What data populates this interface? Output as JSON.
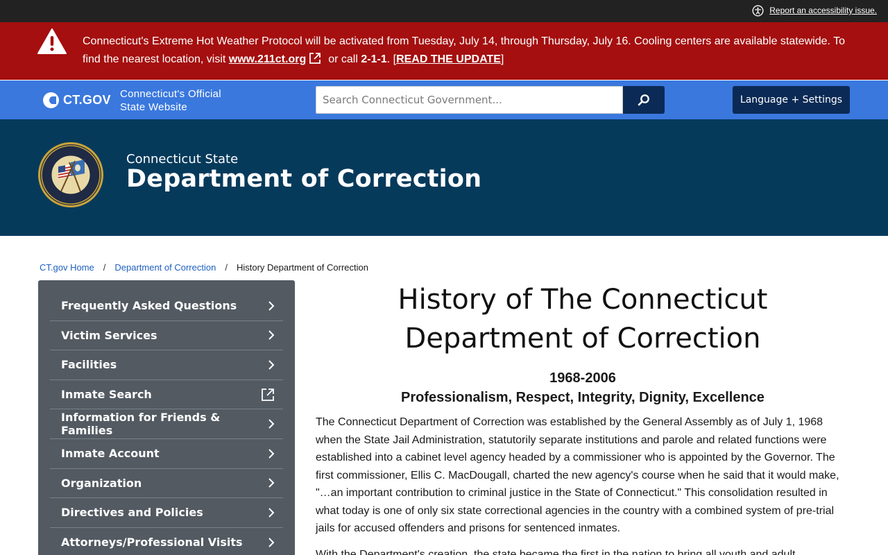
{
  "utility": {
    "accessibility_link": "Report an accessibility issue."
  },
  "alert": {
    "text_before": "Connecticut's Extreme Hot Weather Protocol will be activated from Tuesday, July 14, through Thursday, July 16. Cooling centers are available statewide. To find the nearest location, visit ",
    "link": "www.211ct.org",
    "text_mid": "or call ",
    "phone": "2-1-1",
    "text_after": ". [",
    "read_update": "READ THE UPDATE",
    "close_bracket": "]"
  },
  "ctgov": {
    "wordmark": "CT.GOV",
    "tagline_line1": "Connecticut's Official",
    "tagline_line2": "State Website",
    "search_placeholder": "Search Connecticut Government...",
    "language_button": "Language + Settings"
  },
  "agency": {
    "subtitle": "Connecticut State",
    "title": "Department of Correction"
  },
  "breadcrumb": {
    "home": "CT.gov Home",
    "agency": "Department of Correction",
    "current": "History Department of Correction",
    "separator": "/"
  },
  "sidebar": {
    "items": [
      {
        "label": "Frequently Asked Questions",
        "icon": "chevron-right-icon"
      },
      {
        "label": "Victim Services",
        "icon": "chevron-right-icon"
      },
      {
        "label": "Facilities",
        "icon": "chevron-right-icon"
      },
      {
        "label": "Inmate Search",
        "icon": "external-link-icon"
      },
      {
        "label": "Information for Friends & Families",
        "icon": "chevron-right-icon"
      },
      {
        "label": "Inmate Account",
        "icon": "chevron-right-icon"
      },
      {
        "label": "Organization",
        "icon": "chevron-right-icon"
      },
      {
        "label": "Directives and Policies",
        "icon": "chevron-right-icon"
      },
      {
        "label": "Attorneys/Professional Visits",
        "icon": "chevron-right-icon"
      }
    ]
  },
  "main": {
    "title": "History of The Connecticut Department of Correction",
    "years": "1968-2006",
    "values": "Professionalism, Respect, Integrity, Dignity, Excellence",
    "paragraph1": "The Connecticut Department of Correction was established by the General Assembly as of July 1, 1968 when the State Jail Administration, statutorily separate institutions and parole and related functions were established into a cabinet level agency headed by a commissioner who is appointed by the Governor. The first commissioner, Ellis C. MacDougall, charted the new agency's course when he said that it would make, \"…an important contribution to criminal justice in the State of Connecticut.\" This consolidation resulted in what today is one of only six state correctional agencies in the country with a combined system of pre-trial jails for accused offenders and prisons for sentenced inmates.",
    "paragraph2": "With the Department's creation, the state became the first in the nation to bring all youth and adult"
  },
  "colors": {
    "alert_red": "#a50f0f",
    "ctgov_blue": "#3a78de",
    "agency_navy": "#063a5b",
    "button_navy": "#0b2a55",
    "sidebar_gray": "#535a61"
  }
}
